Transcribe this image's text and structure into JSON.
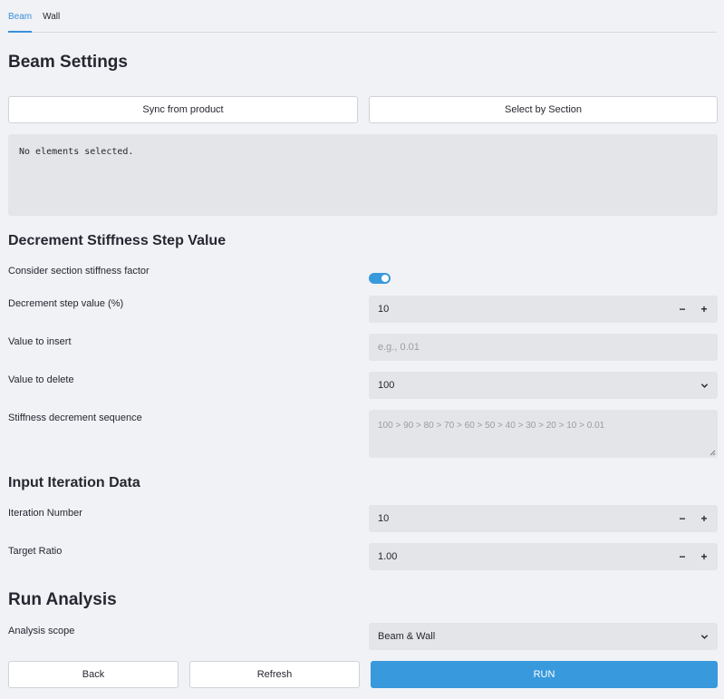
{
  "tabs": [
    "Beam",
    "Wall"
  ],
  "title": "Beam Settings",
  "sync_button": "Sync from product",
  "select_button": "Select by Section",
  "selection_info": "No elements selected.",
  "section_decrement": "Decrement Stiffness Step Value",
  "consider_label": "Consider section stiffness factor",
  "consider_toggle_on": true,
  "step_label": "Decrement step value (%)",
  "step_value": "10",
  "insert_label": "Value to insert",
  "insert_placeholder": "e.g., 0.01",
  "delete_label": "Value to delete",
  "delete_value": "100",
  "sequence_label": "Stiffness decrement sequence",
  "sequence_placeholder": "100 > 90 > 80 > 70 > 60 > 50 > 40 > 30 > 20 > 10 > 0.01",
  "section_iteration": "Input Iteration Data",
  "iteration_label": "Iteration Number",
  "iteration_value": "10",
  "ratio_label": "Target Ratio",
  "ratio_value": "1.00",
  "section_run": "Run Analysis",
  "scope_label": "Analysis scope",
  "scope_value": "Beam & Wall",
  "back_button": "Back",
  "refresh_button": "Refresh",
  "run_button": "RUN",
  "stepper_minus": "−",
  "stepper_plus": "+",
  "accent_color": "#3899dd"
}
